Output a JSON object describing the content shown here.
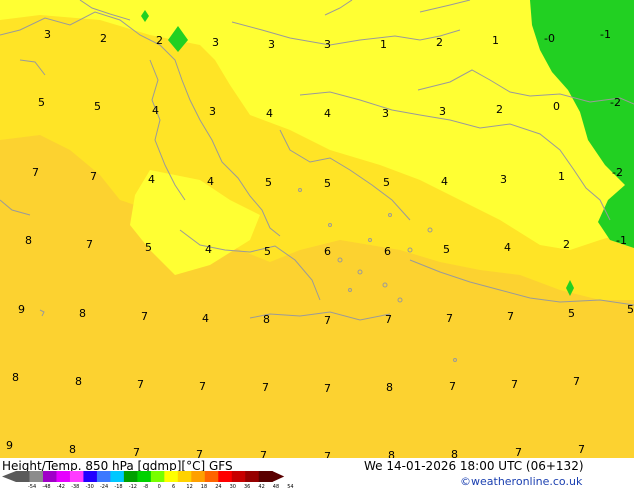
{
  "title": "Height/Temp. 850 hPa [gdmp][°C] GFS",
  "datetime": "We 14-01-2026 18:00 UTC (06+132)",
  "credit": "©weatheronline.co.uk",
  "colors": {
    "light_yellow": "#ffff33",
    "yellow": "#ffee22",
    "orange_yellow": "#fcd230",
    "green": "#22d022",
    "coast": "#9a9a9a"
  },
  "labels": [
    {
      "t": "3"
    },
    {
      "t": "2"
    },
    {
      "t": "2"
    },
    {
      "t": "3"
    },
    {
      "t": "3"
    },
    {
      "t": "3"
    },
    {
      "t": "1"
    },
    {
      "t": "2"
    },
    {
      "t": "1"
    },
    {
      "t": "-0"
    },
    {
      "t": "-1"
    },
    {
      "t": "5"
    },
    {
      "t": "5"
    },
    {
      "t": "4"
    },
    {
      "t": "3"
    },
    {
      "t": "4"
    },
    {
      "t": "4"
    },
    {
      "t": "3"
    },
    {
      "t": "3"
    },
    {
      "t": "2"
    },
    {
      "t": "0"
    },
    {
      "t": "-2"
    },
    {
      "t": "7"
    },
    {
      "t": "7"
    },
    {
      "t": "4"
    },
    {
      "t": "4"
    },
    {
      "t": "5"
    },
    {
      "t": "5"
    },
    {
      "t": "5"
    },
    {
      "t": "4"
    },
    {
      "t": "3"
    },
    {
      "t": "1"
    },
    {
      "t": "-2"
    },
    {
      "t": "8"
    },
    {
      "t": "7"
    },
    {
      "t": "5"
    },
    {
      "t": "4"
    },
    {
      "t": "5"
    },
    {
      "t": "6"
    },
    {
      "t": "6"
    },
    {
      "t": "5"
    },
    {
      "t": "4"
    },
    {
      "t": "2"
    },
    {
      "t": "-1"
    },
    {
      "t": "9"
    },
    {
      "t": "8"
    },
    {
      "t": "7"
    },
    {
      "t": "4"
    },
    {
      "t": "8"
    },
    {
      "t": "7"
    },
    {
      "t": "7"
    },
    {
      "t": "7"
    },
    {
      "t": "7"
    },
    {
      "t": "5"
    },
    {
      "t": "5"
    },
    {
      "t": "8"
    },
    {
      "t": "8"
    },
    {
      "t": "7"
    },
    {
      "t": "7"
    },
    {
      "t": "7"
    },
    {
      "t": "7"
    },
    {
      "t": "8"
    },
    {
      "t": "7"
    },
    {
      "t": "7"
    },
    {
      "t": "7"
    },
    {
      "t": "9"
    },
    {
      "t": "8"
    },
    {
      "t": "7"
    },
    {
      "t": "7"
    },
    {
      "t": "7"
    },
    {
      "t": "7"
    },
    {
      "t": "8"
    },
    {
      "t": "8"
    },
    {
      "t": "7"
    },
    {
      "t": "7"
    }
  ],
  "scale_ticks": [
    "-54",
    "-48",
    "-42",
    "-38",
    "-30",
    "-24",
    "-18",
    "-12",
    "-8",
    "0",
    "6",
    "12",
    "18",
    "24",
    "30",
    "36",
    "42",
    "48",
    "54"
  ],
  "scale_colors": [
    "#5a5a5a",
    "#8c8c8c",
    "#a000c8",
    "#e600ff",
    "#ff3cff",
    "#2200ff",
    "#3c78ff",
    "#00c8ff",
    "#00a000",
    "#00d200",
    "#78ff00",
    "#ffff00",
    "#ffd200",
    "#ffa000",
    "#ff6400",
    "#ff0000",
    "#c80000",
    "#960000",
    "#5a0000"
  ]
}
